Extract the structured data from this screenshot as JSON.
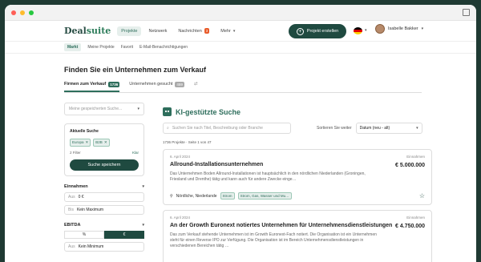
{
  "nav": {
    "logo_part1": "Deal",
    "logo_part2": "suite",
    "items": [
      {
        "label": "Projekte"
      },
      {
        "label": "Netzwerk"
      },
      {
        "label": "Nachrichten",
        "badge": "3"
      },
      {
        "label": "Mehr"
      }
    ],
    "cta_label": "Projekt erstellen",
    "user_name": "Isabelle Bakker"
  },
  "subnav": [
    "Markt",
    "Meine Projekte",
    "Favorit",
    "E-Mail-Benachrichtigungen"
  ],
  "page_title": "Finden Sie ein Unternehmen zum Verkauf",
  "tabs": [
    {
      "label": "Firmen zum Verkauf",
      "count": "1736"
    },
    {
      "label": "Unternehmen gesucht",
      "count": "459"
    }
  ],
  "sidebar": {
    "saved_search_placeholder": "Meine gespeicherten Suche...",
    "current_search_label": "Aktuelle Suche",
    "chips": [
      "Europa",
      "B2B"
    ],
    "filter_count": "2 Filter",
    "clear_label": "Klar",
    "save_button": "Suche speichern",
    "revenue_label": "Einnahmen",
    "revenue_from_prefix": "Aus",
    "revenue_from_value": "0 €",
    "revenue_to_prefix": "Bis",
    "revenue_to_value": "Kein Maximum",
    "ebitda_label": "EBITDA",
    "toggle_percent": "%",
    "toggle_euro": "€",
    "ebitda_from_prefix": "Aus",
    "ebitda_from_value": "Kein Minimum"
  },
  "main": {
    "ai_title": "KI-gestützte Suche",
    "search_placeholder": "Suchen Sie nach Titel, Beschreibung oder Branche",
    "sort_label": "Sortieren Sie weiter",
    "sort_value": "Datum (neu - alt)",
    "results_meta": "1736 Projekte · Seite 1 von 47",
    "listings": [
      {
        "date": "6. April 2024",
        "title": "Allround-Installationsunternehmen",
        "desc": "Das Unternehmen Boden Allround-Installationen ist hauptsächlich in den nördlichen Niederlanden (Groningen, Friesland und Drenthe) tätig und kann auch für andere Zwecke einge…",
        "revenue_label": "Einnahmen",
        "price": "€ 5.000.000",
        "location": "Nördliche, Niederlande",
        "tags": [
          "Strom",
          "Strom, Gas, Wasser und Mu…"
        ]
      },
      {
        "date": "6. April 2024",
        "title": "An der Growth Euronext notiertes Unternehmen für Unternehmensdienstleistungen",
        "desc": "Das zum Verkauf stehende Unternehmen ist im Growth Euronext-Fach notiert. Die Organisation ist ein Unternehmen steht für einen Reverse IPO zur Verfügung. Die Organisation ist im Bereich Unternehmensdienstleistungen in verschiedenen Bereichen tätig …",
        "revenue_label": "Einnahmen",
        "price": "€ 4.750.000"
      }
    ]
  },
  "colors": {
    "brand": "#1f4a40",
    "accent": "#2e6e5c",
    "badge": "#e85b2a"
  }
}
